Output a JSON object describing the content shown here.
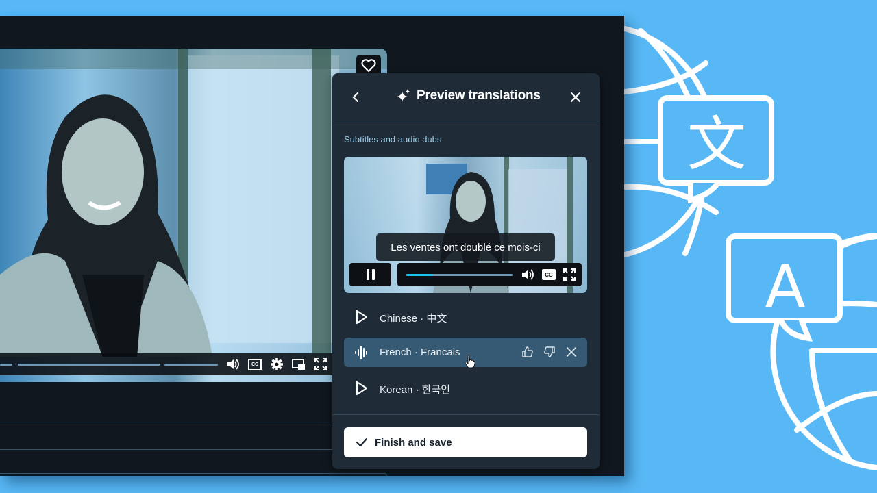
{
  "colors": {
    "background": "#58b8f5",
    "window_bg": "#10171e",
    "panel_bg": "#1f2c38",
    "active_row_bg": "#365a73",
    "accent_progress": "#1ec0f0",
    "section_label": "#9fcbe6"
  },
  "main_player": {
    "favorite_icon": "heart-icon",
    "controls": [
      "volume-icon",
      "closed-captions-icon",
      "settings-gear-icon",
      "picture-in-picture-icon",
      "fullscreen-icon"
    ],
    "cc_label": "CC"
  },
  "panel": {
    "back_icon": "chevron-left-icon",
    "title_icon": "sparkle-icon",
    "title": "Preview translations",
    "close_icon": "close-icon",
    "section_label": "Subtitles and audio dubs",
    "preview": {
      "subtitle": "Les ventes ont doublé ce mois-ci",
      "state": "playing",
      "progress_percent": 25,
      "cc_label": "CC"
    },
    "languages": [
      {
        "label": "Chinese · 中文",
        "icon": "play-icon",
        "active": false
      },
      {
        "label": "French · Francais",
        "icon": "audio-waveform-icon",
        "active": true,
        "actions": [
          "thumbs-up-icon",
          "thumbs-down-icon",
          "remove-icon"
        ]
      },
      {
        "label": "Korean · 한국인",
        "icon": "play-icon",
        "active": false
      }
    ],
    "finish_button": "Finish and save"
  },
  "decoration": {
    "badges": [
      "文",
      "A"
    ]
  }
}
